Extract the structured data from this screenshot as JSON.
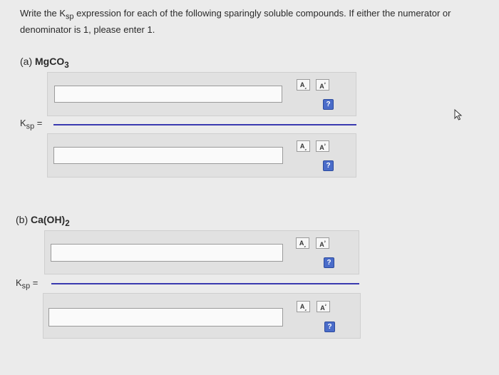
{
  "instructions": {
    "pre": "Write the K",
    "sub": "sp",
    "post": " expression for each of the following sparingly soluble compounds. If either the numerator or denominator is 1, please enter 1."
  },
  "parts": [
    {
      "prefix": "(a) ",
      "compound_main": "MgCO",
      "compound_sub": "3",
      "ksp_main": "K",
      "ksp_sub": "sp",
      "equals": "=",
      "numerator": {
        "value": "",
        "sub_btn": "A",
        "sub_btn_mark": "₂",
        "sup_btn": "A",
        "sup_btn_mark": "²",
        "help": "?"
      },
      "denominator": {
        "value": "",
        "sub_btn": "A",
        "sub_btn_mark": "₂",
        "sup_btn": "A",
        "sup_btn_mark": "²",
        "help": "?"
      }
    },
    {
      "prefix": "(b) ",
      "compound_main": "Ca(OH)",
      "compound_sub": "2",
      "ksp_main": "K",
      "ksp_sub": "sp",
      "equals": "=",
      "numerator": {
        "value": "",
        "sub_btn": "A",
        "sub_btn_mark": "₂",
        "sup_btn": "A",
        "sup_btn_mark": "²",
        "help": "?"
      },
      "denominator": {
        "value": "",
        "sub_btn": "A",
        "sub_btn_mark": "₂",
        "sup_btn": "A",
        "sup_btn_mark": "²",
        "help": "?"
      }
    }
  ],
  "colors": {
    "fraction_bar": "#3a3ab0",
    "help_button": "#4a6cc9",
    "background": "#ebebeb"
  }
}
